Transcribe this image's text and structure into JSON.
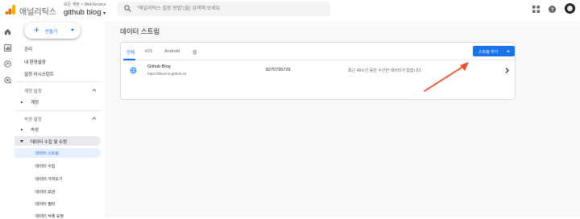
{
  "app": {
    "brand": "애널리틱스",
    "account_breadcrumb": "모든 계정 > WebService",
    "property_name": "github blog"
  },
  "search": {
    "placeholder": "\"애널리틱스 설정 방법\"(을) 검색해 보세요"
  },
  "toolbar_icons": [
    "apps-grid-icon",
    "help-icon",
    "account-avatar"
  ],
  "rail_icons": [
    "home-icon",
    "reports-icon",
    "explore-icon",
    "advertising-icon"
  ],
  "sidebar": {
    "create_label": "만들기",
    "items": [
      "관리",
      "내 환경설정",
      "설정 어시스턴트"
    ],
    "account_section": {
      "header": "계정 설정",
      "items": [
        "계정"
      ]
    },
    "property_section": {
      "header": "속성 설정",
      "items": [
        "속성"
      ],
      "group": "데이터 수집 및 수정",
      "sub_items": [
        "데이터 스트림",
        "데이터 수집",
        "데이터 가져오기",
        "데이터 보관",
        "데이터 필터",
        "데이터 삭제 요청"
      ]
    }
  },
  "main": {
    "title": "데이터 스트림",
    "tabs": [
      "전체",
      "iOS",
      "Android",
      "웹"
    ],
    "active_tab": "전체",
    "add_stream_label": "스트림 추가",
    "streams": [
      {
        "name": "Github Blog",
        "url": "https://bluemiv.github.io/",
        "id": "8270730729",
        "status": "최근 48시간 동안 수신한 데이터가 없습니다."
      }
    ]
  },
  "colors": {
    "accent": "#1a73e8",
    "active_bg": "#e8f0fe",
    "annotation_arrow": "#e8502f"
  }
}
